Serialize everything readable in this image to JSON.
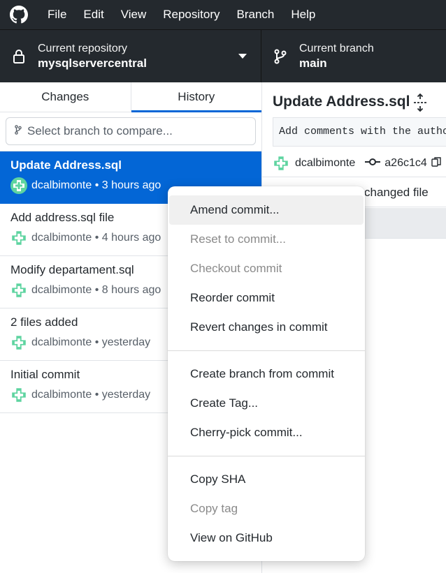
{
  "menubar": {
    "logo": "github-logo",
    "items": [
      "File",
      "Edit",
      "View",
      "Repository",
      "Branch",
      "Help"
    ]
  },
  "toolbar": {
    "repo_label": "Current repository",
    "repo_value": "mysqlservercentral",
    "branch_label": "Current branch",
    "branch_value": "main"
  },
  "tabs": {
    "changes": "Changes",
    "history": "History",
    "active": "History"
  },
  "compare": {
    "placeholder": "Select branch to compare..."
  },
  "commits": [
    {
      "title": "Update Address.sql",
      "author": "dcalbimonte",
      "time": "3 hours ago",
      "selected": true
    },
    {
      "title": "Add address.sql file",
      "author": "dcalbimonte",
      "time": "4 hours ago",
      "selected": false
    },
    {
      "title": "Modify departament.sql",
      "author": "dcalbimonte",
      "time": "8 hours ago",
      "selected": false
    },
    {
      "title": "2 files added",
      "author": "dcalbimonte",
      "time": "yesterday",
      "selected": false
    },
    {
      "title": "Initial commit",
      "author": "dcalbimonte",
      "time": "yesterday",
      "selected": false
    }
  ],
  "detail": {
    "title": "Update Address.sql",
    "description": "Add comments with the autho",
    "author": "dcalbimonte",
    "sha": "a26c1c4",
    "files_changed": "changed file"
  },
  "context_menu": {
    "groups": [
      [
        {
          "label": "Amend commit...",
          "disabled": false,
          "hover": true
        },
        {
          "label": "Reset to commit...",
          "disabled": true
        },
        {
          "label": "Checkout commit",
          "disabled": true
        },
        {
          "label": "Reorder commit",
          "disabled": false
        },
        {
          "label": "Revert changes in commit",
          "disabled": false
        }
      ],
      [
        {
          "label": "Create branch from commit",
          "disabled": false
        },
        {
          "label": "Create Tag...",
          "disabled": false
        },
        {
          "label": "Cherry-pick commit...",
          "disabled": false
        }
      ],
      [
        {
          "label": "Copy SHA",
          "disabled": false
        },
        {
          "label": "Copy tag",
          "disabled": true
        },
        {
          "label": "View on GitHub",
          "disabled": false
        }
      ]
    ]
  },
  "colors": {
    "accent": "#0366d6",
    "dark": "#24292e",
    "avatar": "#5ed4a0"
  }
}
